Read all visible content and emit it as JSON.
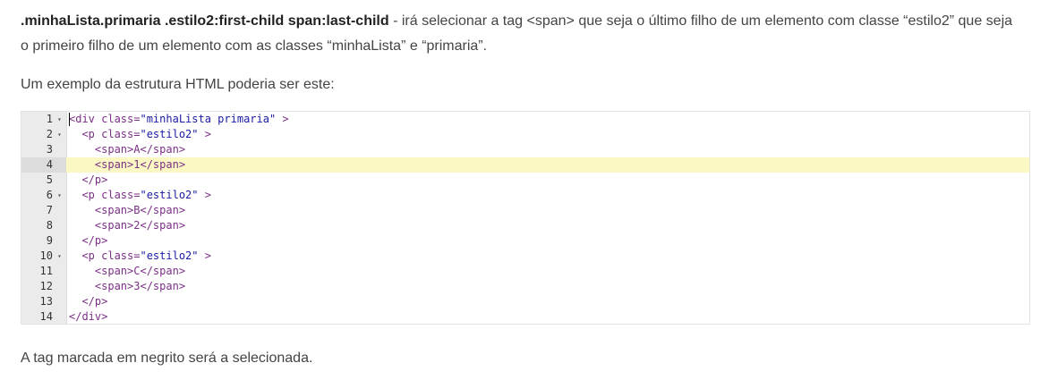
{
  "intro": {
    "selector": ".minhaLista.primaria .estilo2:first-child span:last-child",
    "text": " - irá selecionar a tag <span> que seja o último filho de um elemento com classe “estilo2” que seja o primeiro filho de um elemento com as classes “minhaLista” e “primaria”."
  },
  "example_intro": "Um exemplo da estrutura HTML poderia ser este:",
  "code_lines": [
    {
      "number": "1",
      "indent": "",
      "before": "<div class=",
      "attr": "\"minhaLista primaria\"",
      "after": " >",
      "fold": true
    },
    {
      "number": "2",
      "indent": "  ",
      "before": "<p class=",
      "attr": "\"estilo2\"",
      "after": " >",
      "fold": true
    },
    {
      "number": "3",
      "indent": "    ",
      "before": "<span>A</span>",
      "attr": "",
      "after": "",
      "fold": false
    },
    {
      "number": "4",
      "indent": "    ",
      "before": "<span>1</span>",
      "attr": "",
      "after": "",
      "fold": false,
      "active": true
    },
    {
      "number": "5",
      "indent": "  ",
      "before": "</p>",
      "attr": "",
      "after": "",
      "fold": false
    },
    {
      "number": "6",
      "indent": "  ",
      "before": "<p class=",
      "attr": "\"estilo2\"",
      "after": " >",
      "fold": true
    },
    {
      "number": "7",
      "indent": "    ",
      "before": "<span>B</span>",
      "attr": "",
      "after": "",
      "fold": false
    },
    {
      "number": "8",
      "indent": "    ",
      "before": "<span>2</span>",
      "attr": "",
      "after": "",
      "fold": false
    },
    {
      "number": "9",
      "indent": "  ",
      "before": "</p>",
      "attr": "",
      "after": "",
      "fold": false
    },
    {
      "number": "10",
      "indent": "  ",
      "before": "<p class=",
      "attr": "\"estilo2\"",
      "after": " >",
      "fold": true
    },
    {
      "number": "11",
      "indent": "    ",
      "before": "<span>C</span>",
      "attr": "",
      "after": "",
      "fold": false
    },
    {
      "number": "12",
      "indent": "    ",
      "before": "<span>3</span>",
      "attr": "",
      "after": "",
      "fold": false
    },
    {
      "number": "13",
      "indent": "  ",
      "before": "</p>",
      "attr": "",
      "after": "",
      "fold": false
    },
    {
      "number": "14",
      "indent": "",
      "before": "</div>",
      "attr": "",
      "after": "",
      "fold": false
    }
  ],
  "fold_icon": "fold-arrow-icon",
  "closing": "A tag marcada em negrito será a selecionada.",
  "colors": {
    "tag": "#7a2f85",
    "attribute_value": "#1a1aa6",
    "active_line": "#fcf8c3",
    "gutter": "#ebebeb"
  }
}
